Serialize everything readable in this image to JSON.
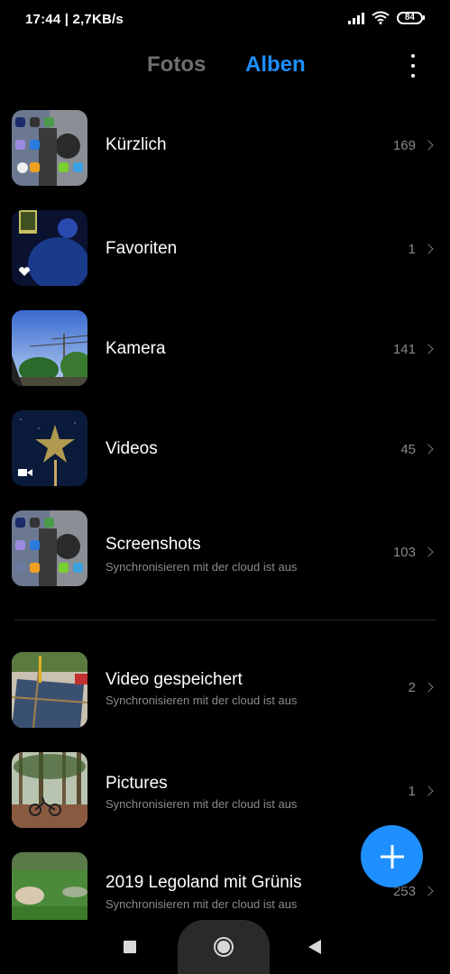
{
  "status": {
    "time_net": "17:44 | 2,7KB/s",
    "battery": "84"
  },
  "tabs": {
    "fotos": "Fotos",
    "alben": "Alben"
  },
  "albums": [
    {
      "title": "Kürzlich",
      "count": "169",
      "subtitle": ""
    },
    {
      "title": "Favoriten",
      "count": "1",
      "subtitle": ""
    },
    {
      "title": "Kamera",
      "count": "141",
      "subtitle": ""
    },
    {
      "title": "Videos",
      "count": "45",
      "subtitle": ""
    },
    {
      "title": "Screenshots",
      "count": "103",
      "subtitle": "Synchronisieren mit der cloud ist aus"
    },
    {
      "title": "Video gespeichert",
      "count": "2",
      "subtitle": "Synchronisieren mit der cloud ist aus"
    },
    {
      "title": "Pictures",
      "count": "1",
      "subtitle": "Synchronisieren mit der cloud ist aus"
    },
    {
      "title": "2019 Legoland mit Grünis",
      "count": "253",
      "subtitle": "Synchronisieren mit der cloud ist aus"
    }
  ],
  "icons": {
    "more": "more-vertical-icon",
    "heart": "heart-icon",
    "video": "video-camera-icon",
    "add": "plus-icon"
  },
  "colors": {
    "accent": "#1e8fff",
    "inactive_tab": "#6f6f6f"
  }
}
